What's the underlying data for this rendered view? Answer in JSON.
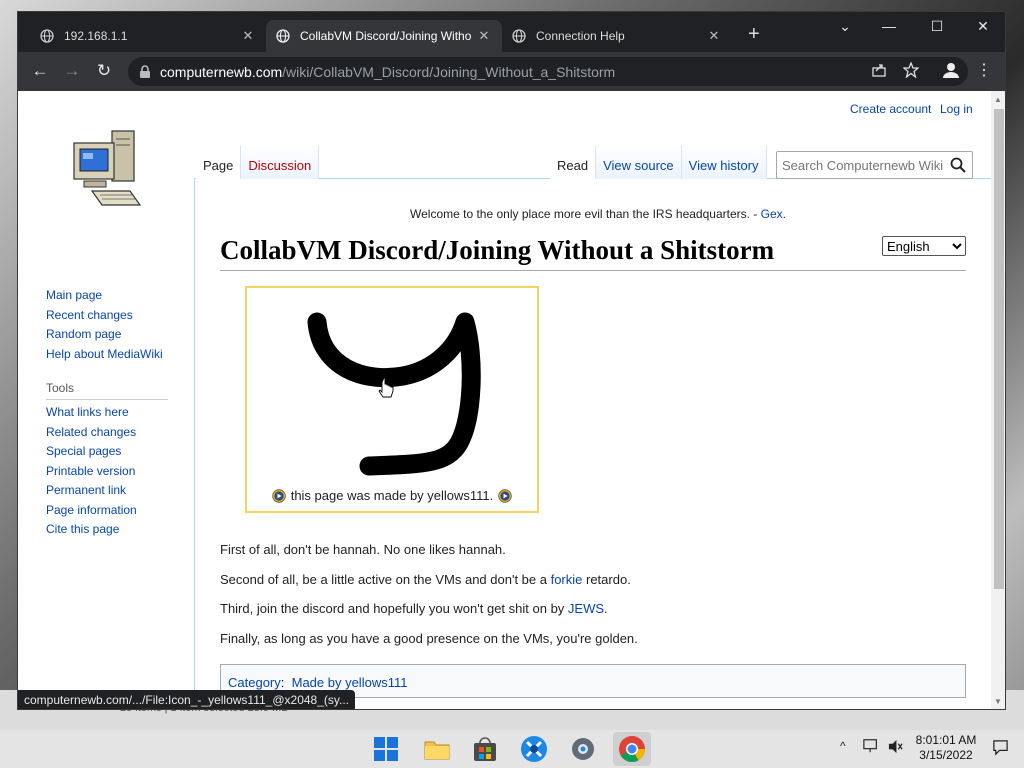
{
  "browser": {
    "tabs": [
      {
        "title": "192.168.1.1",
        "close": "✕"
      },
      {
        "title": "CollabVM Discord/Joining Witho",
        "close": "✕"
      },
      {
        "title": "Connection Help",
        "close": "✕"
      }
    ],
    "new_tab": "+",
    "window_controls": {
      "dropdown": "⌄",
      "minimize": "—",
      "maximize": "☐",
      "close": "✕"
    },
    "nav": {
      "back": "←",
      "forward": "→",
      "reload": "↻"
    },
    "url_host": "computernewb.com",
    "url_path": "/wiki/CollabVM_Discord/Joining_Without_a_Shitstorm",
    "menu": "⋮"
  },
  "wiki": {
    "personal": {
      "create_account": "Create account",
      "login": "Log in"
    },
    "nav_links": [
      "Main page",
      "Recent changes",
      "Random page",
      "Help about MediaWiki"
    ],
    "tools_heading": "Tools",
    "tools_links": [
      "What links here",
      "Related changes",
      "Special pages",
      "Printable version",
      "Permanent link",
      "Page information",
      "Cite this page"
    ],
    "tabs_left": [
      "Page",
      "Discussion"
    ],
    "tabs_right": [
      "Read",
      "View source",
      "View history"
    ],
    "search_placeholder": "Search Computernewb Wiki",
    "sitenotice_text": "Welcome to the only place more evil than the IRS headquarters. - ",
    "sitenotice_link": "Gex",
    "sitenotice_end": ".",
    "title": "CollabVM Discord/Joining Without a Shitstorm",
    "language": "English",
    "image_caption": "this page was made by yellows111.",
    "paragraphs": {
      "p1": "First of all, don't be hannah. No one likes hannah.",
      "p2_start": "Second of all, be a little active on the VMs and don't be a ",
      "p2_link": "forkie",
      "p2_end": " retardo.",
      "p3_start": "Third, join the discord and hopefully you won't get shit on by ",
      "p3_link": "JEWS",
      "p3_end": ".",
      "p4": "Finally, as long as you have a good presence on the VMs, you're golden."
    },
    "category_label": "Category",
    "category_sep": ":",
    "category_value": "Made by yellows111"
  },
  "status_url": "computernewb.com/.../File:Icon_-_yellows111_@x2048_(sy...",
  "background_status": "25 items  |  1 item selected  23.9 MB",
  "taskbar": {
    "clock_time": "8:01:01 AM",
    "clock_date": "3/15/2022",
    "tray_caret": "^"
  },
  "colors": {
    "link": "#0645ad",
    "redlink": "#ba0000",
    "thumb_border": "#f4d35e",
    "chrome_dark": "#202124"
  }
}
